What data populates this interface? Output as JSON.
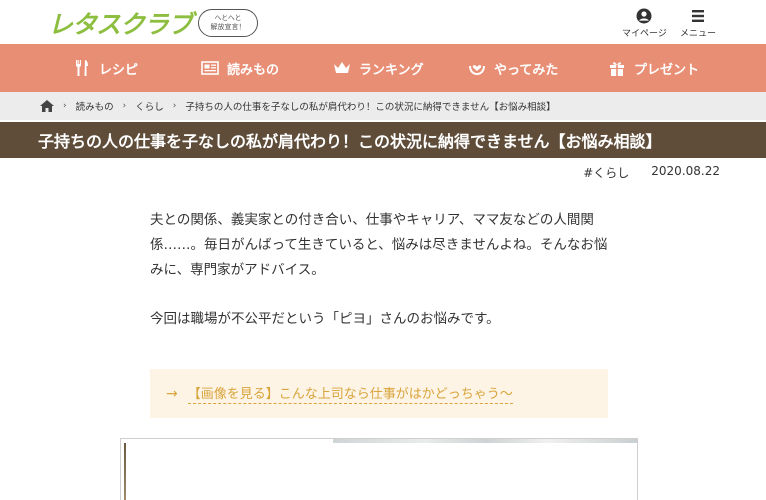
{
  "header": {
    "logo_text": "レタスクラブ",
    "badge_line1": "へとへと",
    "badge_line2": "解放宣言！",
    "mypage_label": "マイページ",
    "menu_label": "メニュー"
  },
  "nav": {
    "items": [
      {
        "label": "レシピ",
        "icon": "fork-knife-icon"
      },
      {
        "label": "読みもの",
        "icon": "newspaper-icon"
      },
      {
        "label": "ランキング",
        "icon": "crown-icon"
      },
      {
        "label": "やってみた",
        "icon": "hands-heart-icon"
      },
      {
        "label": "プレゼント",
        "icon": "gift-icon"
      }
    ]
  },
  "breadcrumb": {
    "items": [
      "読みもの",
      "くらし",
      "子持ちの人の仕事を子なしの私が肩代わり！この状況に納得できません【お悩み相談】"
    ]
  },
  "article": {
    "title": "子持ちの人の仕事を子なしの私が肩代わり！この状況に納得できません【お悩み相談】",
    "tag": "#くらし",
    "date": "2020.08.22",
    "para1": "夫との関係、義実家との付き合い、仕事やキャリア、ママ友などの人間関係……。毎日がんばって生きていると、悩みは尽きませんよね。そんなお悩みに、専門家がアドバイス。",
    "para2": "今回は職場が不公平だという「ピヨ」さんのお悩みです。",
    "link_arrow": "→",
    "link_text": "【画像を見る】こんな上司なら仕事がはかどっちゃう〜"
  },
  "colors": {
    "nav_bg": "#e88e74",
    "title_bg": "#5f4d3a",
    "logo_green": "#8dbe3f",
    "link_gold": "#d9a43b",
    "link_box_bg": "#fdf4e6"
  }
}
